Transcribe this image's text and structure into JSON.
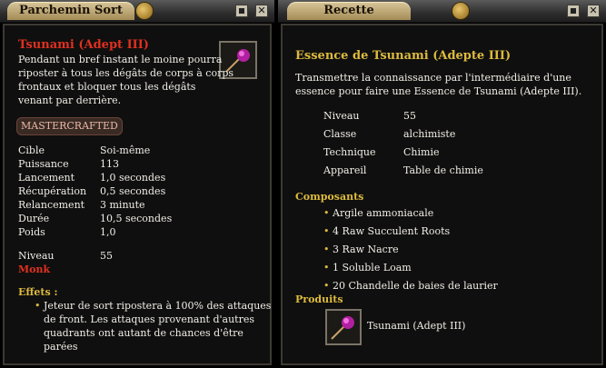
{
  "left": {
    "title": "Parchemin Sort",
    "spell_name": "Tsunami (Adept III)",
    "description": [
      "Pendant un bref instant le moine pourra",
      "riposter à tous les dégâts de corps à corps",
      "frontaux et bloquer tous les dégâts",
      "venant par derrière."
    ],
    "badge": "MASTERCRAFTED",
    "stats": [
      {
        "label": "Cible",
        "value": "Soi-même"
      },
      {
        "label": "Puissance",
        "value": "113"
      },
      {
        "label": "Lancement",
        "value": "1,0 secondes"
      },
      {
        "label": "Récupération",
        "value": "0,5 secondes"
      },
      {
        "label": "Relancement",
        "value": "3 minute"
      },
      {
        "label": "Durée",
        "value": "10,5 secondes"
      },
      {
        "label": "Poids",
        "value": "1,0"
      }
    ],
    "level_label": "Niveau",
    "level_value": "55",
    "class_name": "Monk",
    "effects_label": "Effets :",
    "effects_text": [
      "Jeteur de sort ripostera à 100% des attaques",
      "de front.  Les attaques provenant d'autres",
      "quadrants ont autant de chances d'être",
      "parées"
    ]
  },
  "right": {
    "title": "Recette",
    "recipe_name": "Essence de Tsunami (Adepte III)",
    "description": [
      "Transmettre la connaissance par l'intermédiaire d'une",
      "essence pour faire une Essence de Tsunami (Adepte III)."
    ],
    "info": [
      {
        "label": "Niveau",
        "value": "55"
      },
      {
        "label": "Classe",
        "value": "alchimiste"
      },
      {
        "label": "Technique",
        "value": "Chimie"
      },
      {
        "label": "Appareil",
        "value": "Table de chimie"
      }
    ],
    "components_label": "Composants",
    "components": [
      "Argile ammoniacale",
      "4 Raw Succulent Roots",
      "3 Raw Nacre",
      "1 Soluble Loam",
      "20 Chandelle de baies de laurier"
    ],
    "products_label": "Produits",
    "product_name": "Tsunami (Adept III)"
  },
  "colors": {
    "title_red": "#e03020",
    "section_gold": "#ddbb3e",
    "text": "#f1eee6"
  },
  "icons": {
    "minimize": "minimize-icon",
    "close": "close-icon",
    "scroll": "scroll-icon",
    "spell": "spell-gem-icon"
  }
}
